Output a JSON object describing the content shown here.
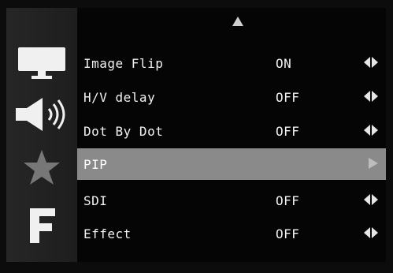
{
  "sidebar": {
    "icons": [
      {
        "name": "monitor-icon"
      },
      {
        "name": "speaker-icon"
      },
      {
        "name": "star-icon"
      },
      {
        "name": "function-f-icon",
        "glyph": "F"
      }
    ]
  },
  "menu": {
    "scroll_up_icon": "up-arrow-icon",
    "rows": [
      {
        "label": "Image Flip",
        "value": "ON"
      },
      {
        "label": "H/V delay",
        "value": "OFF"
      },
      {
        "label": "Dot By Dot",
        "value": "OFF"
      },
      {
        "label": "PIP",
        "value": ""
      },
      {
        "label": "SDI",
        "value": "OFF"
      },
      {
        "label": "Effect",
        "value": "OFF"
      }
    ]
  },
  "colors": {
    "selected_row": "#8a8a8a",
    "text": "#f2f2f2",
    "icon": "#e6e6e6"
  }
}
